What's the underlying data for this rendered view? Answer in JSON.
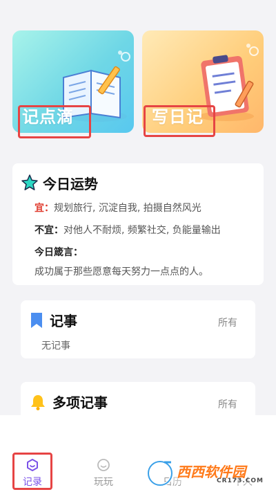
{
  "cards": {
    "left_label": "记点滴",
    "right_label": "写日记"
  },
  "fortune": {
    "title": "今日运势",
    "good_key": "宜：",
    "good_text": "规划旅行, 沉淀自我, 拍摄自然风光",
    "bad_key": "不宜：",
    "bad_text": "对他人不耐烦, 频繁社交, 负能量输出",
    "motto_title": "今日箴言：",
    "motto_text": "成功属于那些愿意每天努力一点点的人。"
  },
  "notes": {
    "title": "记事",
    "all_label": "所有",
    "empty_text": "无记事"
  },
  "multi_notes": {
    "title": "多项记事",
    "all_label": "所有"
  },
  "tabs": [
    {
      "label": "记录",
      "active": true
    },
    {
      "label": "玩玩",
      "active": false
    },
    {
      "label": "日历",
      "active": false
    },
    {
      "label": "个人",
      "active": false
    }
  ],
  "watermark": {
    "brand": "西西软件园",
    "domain": "CR173.COM"
  },
  "colors": {
    "accent_purple": "#7b52e8",
    "highlight_red": "#e64444",
    "good_red": "#e03b2e"
  }
}
